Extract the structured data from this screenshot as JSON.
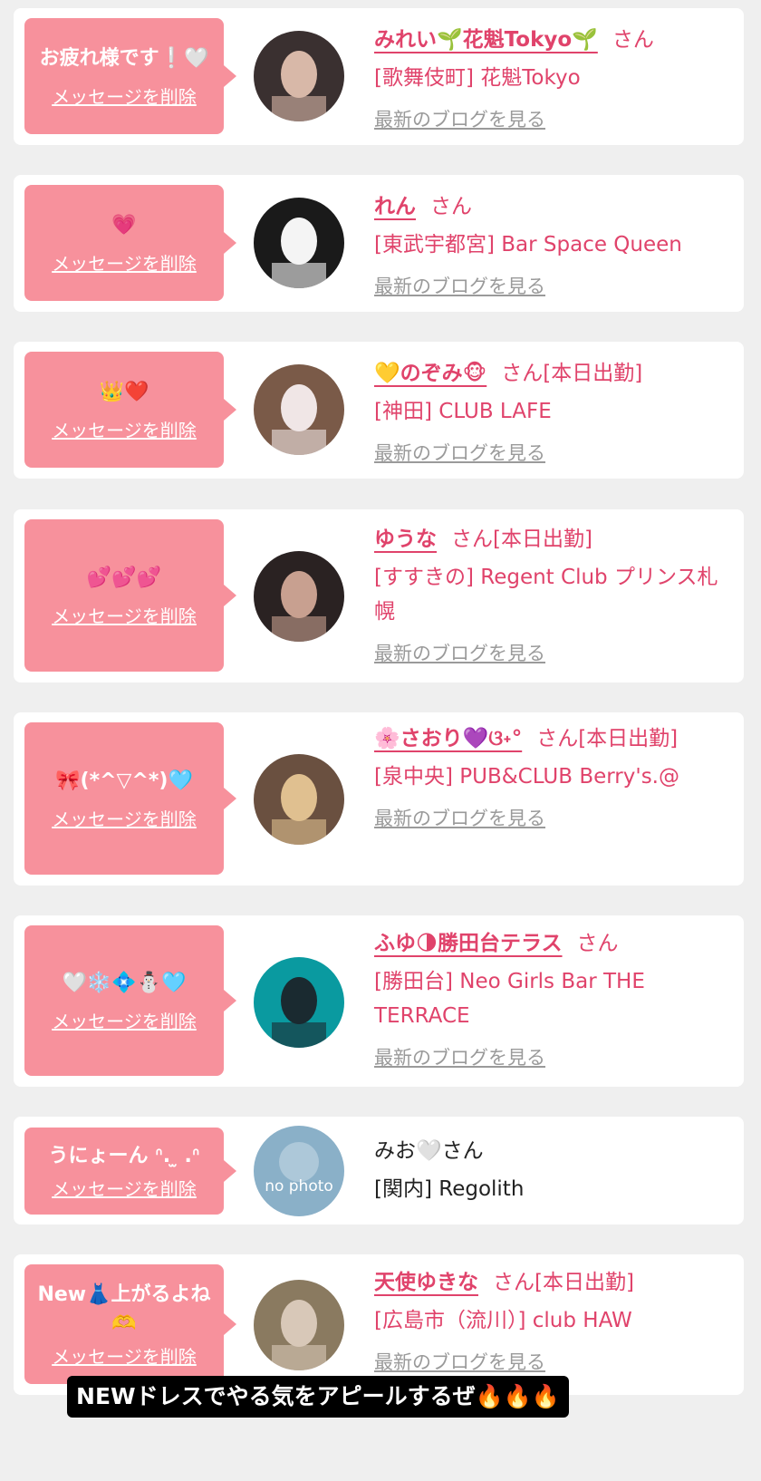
{
  "delete_label": "メッセージを削除",
  "blog_label": "最新のブログを見る",
  "san_label": "さん",
  "items": [
    {
      "message": "お疲れ様です❕🤍",
      "name": "みれい🌱花魁Tokyo🌱",
      "status": "",
      "shop": "[歌舞伎町] 花魁Tokyo",
      "avatar_colors": [
        "#3a3030",
        "#d8b8a8"
      ]
    },
    {
      "message": "💗",
      "name": "れん",
      "status": "",
      "shop": "[東武宇都宮] Bar Space Queen",
      "avatar_colors": [
        "#1a1a1a",
        "#f4f4f4"
      ]
    },
    {
      "message": "👑❤️",
      "name": "💛のぞみ🐵",
      "status": "[本日出勤]",
      "shop": "[神田] CLUB LAFE",
      "avatar_colors": [
        "#7a5a48",
        "#f0e6e6"
      ]
    },
    {
      "message": "💕💕💕",
      "name": "ゆうな",
      "status": "[本日出勤]",
      "shop": "[すすきの] Regent Club プリンス札幌",
      "avatar_colors": [
        "#2a2222",
        "#c8a090"
      ]
    },
    {
      "message": "🎀(*^▽^*)🩵",
      "name": "🌸さおり💜ଓ˖°",
      "status": "[本日出勤]",
      "shop": "[泉中央] PUB&CLUB Berry's.@",
      "avatar_colors": [
        "#6a5040",
        "#e0c090"
      ]
    },
    {
      "message": "🤍❄️💠⛄🩵",
      "name": "ふゆ🌗勝田台テラス",
      "status": "",
      "shop": "[勝田台] Neo Girls Bar THE TERRACE",
      "avatar_colors": [
        "#0a9aa0",
        "#1a2a30"
      ]
    },
    {
      "message": "うにょーん ᐢ. ̫ .ᐢ",
      "name": "みお🤍",
      "status": "",
      "shop": "[関内] Regolith",
      "avatar_colors": [
        "#8ab0c8",
        "#d0e0ea"
      ],
      "avatar_text": "no photo",
      "plain": true
    },
    {
      "message": "New👗上がるよね🫶",
      "name": "天使ゆきな",
      "status": "[本日出勤]",
      "shop": "[広島市（流川）] club HAW",
      "avatar_colors": [
        "#8a7a60",
        "#d8c8b8"
      ]
    }
  ],
  "caption": "NEWドレスでやる気をアピールするぜ🔥🔥🔥"
}
